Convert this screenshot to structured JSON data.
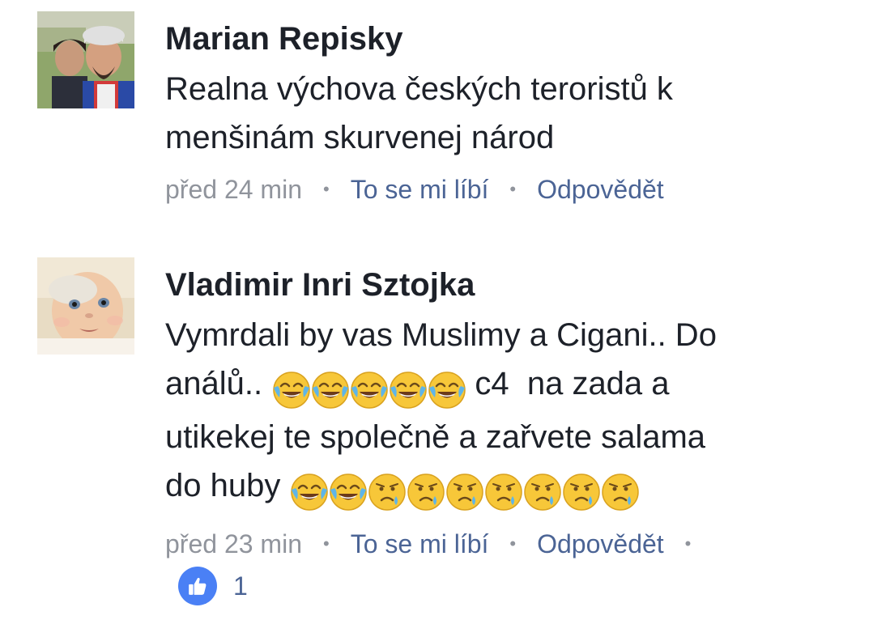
{
  "comments": [
    {
      "author": "Marian Repisky",
      "text_lines": [
        "Realna výchova českých teroristů k",
        "menšinám skurvenej národ"
      ],
      "time": "před 24 min",
      "like_label": "To se mi líbí",
      "reply_label": "Odpovědět",
      "avatar_icon": "avatar-photo-couple"
    },
    {
      "author": "Vladimir Inri Sztojka",
      "text_line_1": "Vymrdali by vas Muslimy a Cigani.. Do",
      "text_line_2_prefix": "análů..",
      "text_line_2_suffix": "c4  na zada a",
      "text_line_3": "utikekej te společně a zařvete salama",
      "text_line_4_prefix": "do huby",
      "emoji_group_1": [
        "face-with-tears-of-joy",
        "face-with-tears-of-joy",
        "face-with-tears-of-joy",
        "face-with-tears-of-joy",
        "face-with-tears-of-joy"
      ],
      "emoji_group_2": [
        "face-with-tears-of-joy",
        "face-with-tears-of-joy",
        "sad-but-relieved-face",
        "sad-but-relieved-face",
        "sad-but-relieved-face",
        "sad-but-relieved-face",
        "sad-but-relieved-face",
        "sad-but-relieved-face",
        "sad-but-relieved-face"
      ],
      "time": "před 23 min",
      "like_label": "To se mi líbí",
      "reply_label": "Odpovědět",
      "like_count": "1",
      "avatar_icon": "avatar-photo-baby"
    }
  ],
  "colors": {
    "author": "#1d2129",
    "meta_gray": "#90949c",
    "link_blue": "#4b6495",
    "like_badge": "#4a80f5"
  }
}
